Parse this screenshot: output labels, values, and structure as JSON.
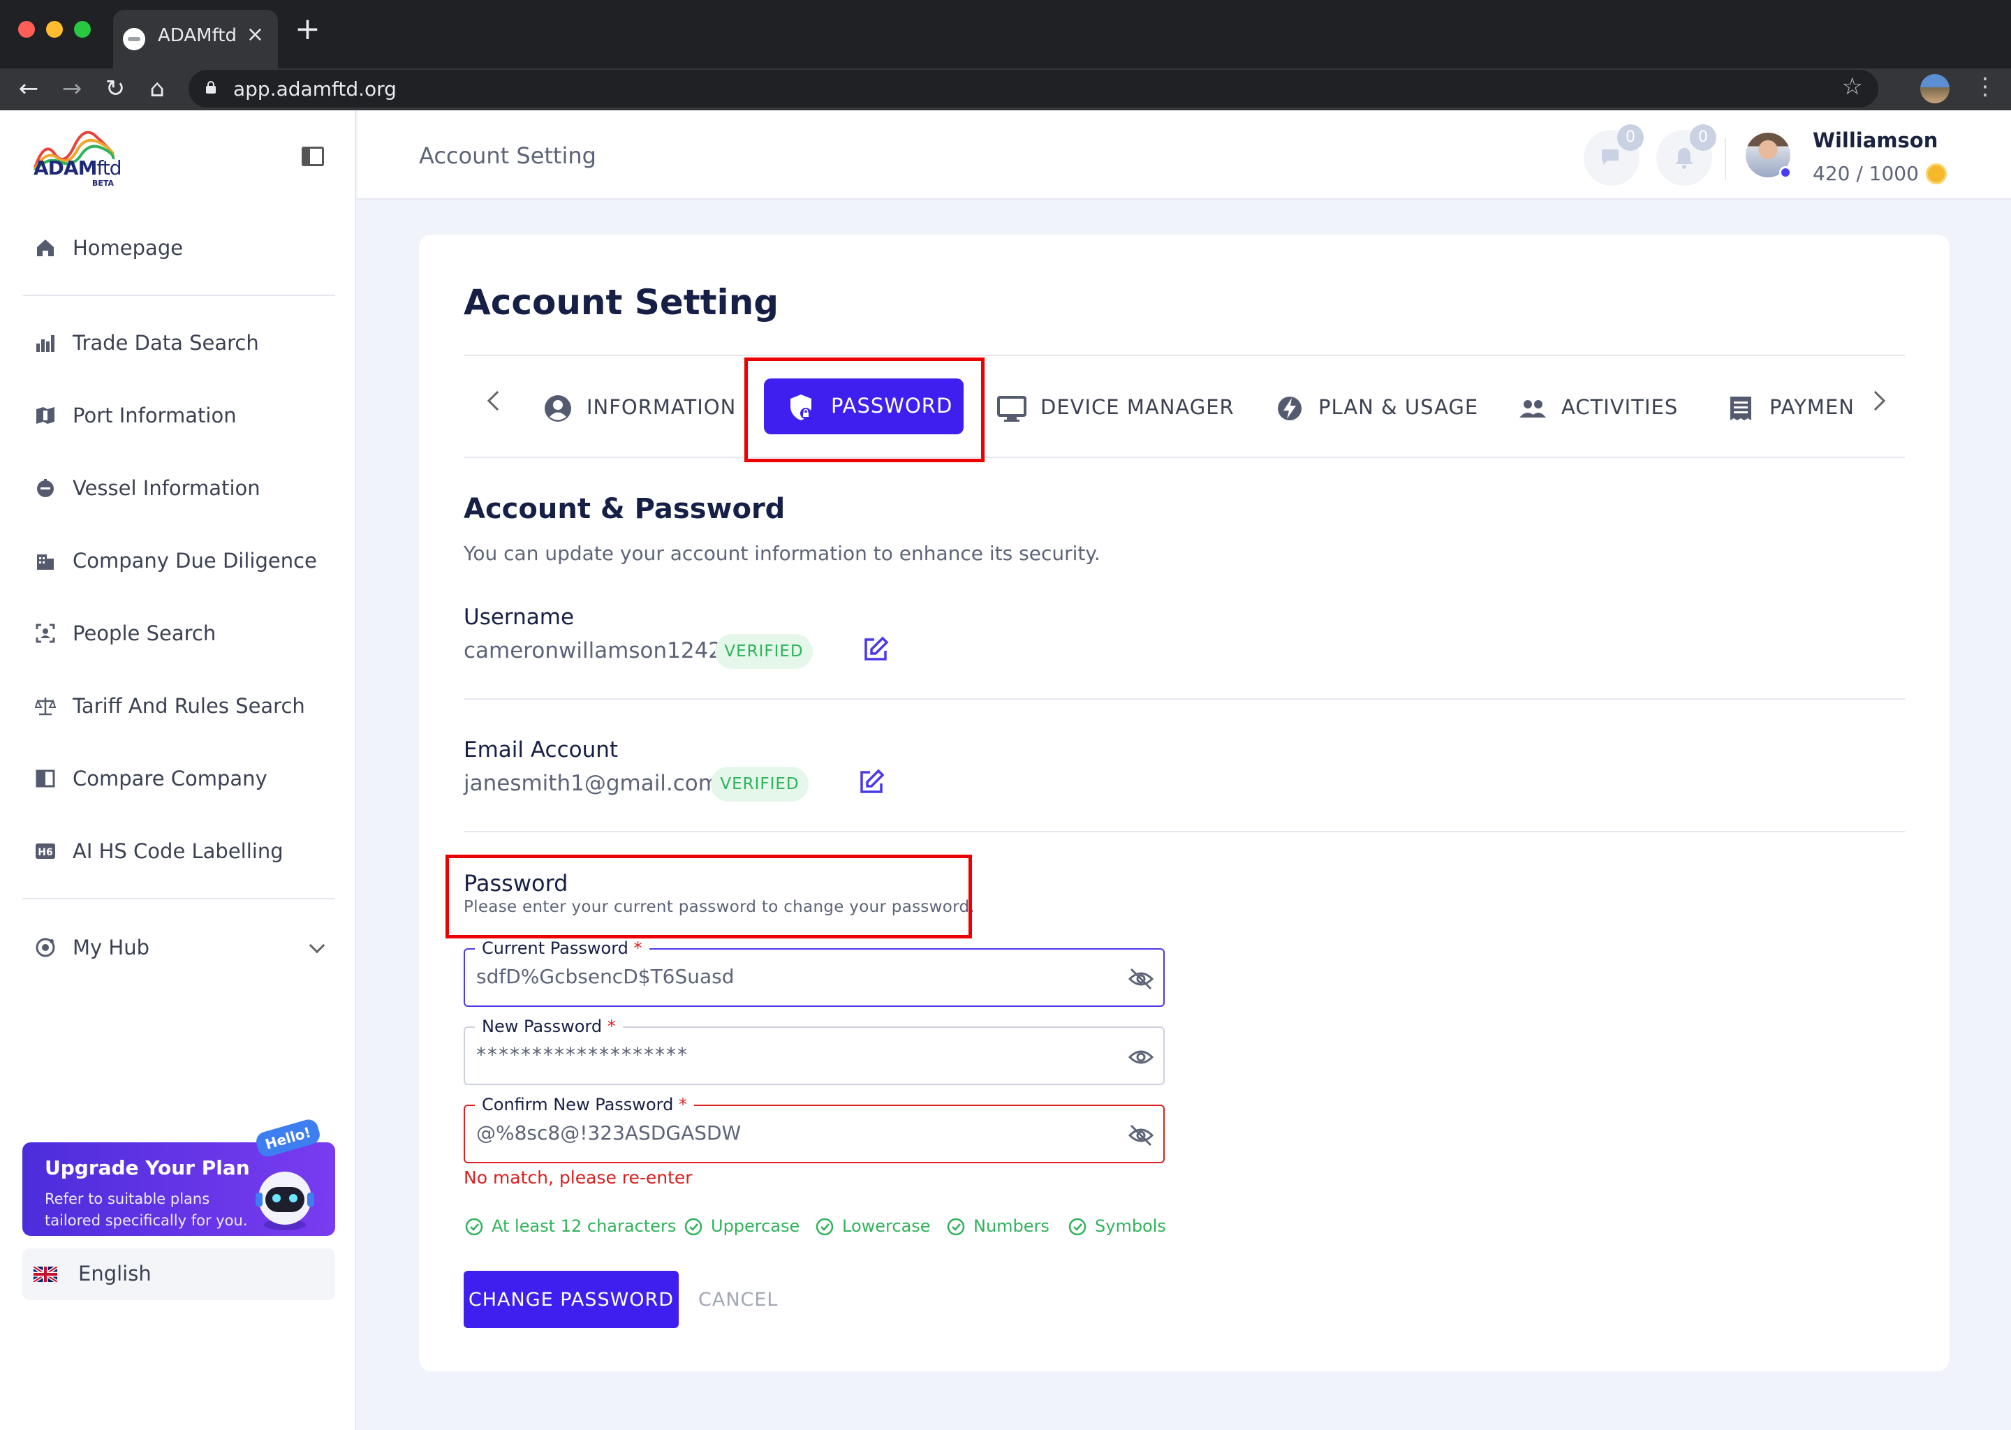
{
  "browser": {
    "tab_title": "ADAMftd",
    "url": "app.adamftd.org"
  },
  "sidebar": {
    "logo_main": "ADAM",
    "logo_suffix": "ftd",
    "logo_beta": "BETA",
    "items": [
      {
        "label": "Homepage",
        "icon": "home-icon"
      },
      {
        "label": "Trade Data Search",
        "icon": "bar-chart-icon"
      },
      {
        "label": "Port Information",
        "icon": "port-icon"
      },
      {
        "label": "Vessel Information",
        "icon": "vessel-icon"
      },
      {
        "label": "Company Due Diligence",
        "icon": "building-icon"
      },
      {
        "label": "People Search",
        "icon": "person-scan-icon"
      },
      {
        "label": "Tariff And Rules Search",
        "icon": "scale-icon"
      },
      {
        "label": "Compare Company",
        "icon": "compare-icon"
      },
      {
        "label": "AI HS Code Labelling",
        "icon": "hs-code-icon"
      },
      {
        "label": "My Hub",
        "icon": "hub-icon"
      }
    ],
    "upgrade": {
      "title": "Upgrade Your Plan",
      "description": "Refer to suitable plans tailored specifically for you.",
      "bubble": "Hello!"
    },
    "language": "English"
  },
  "header": {
    "title": "Account Setting",
    "messages_count": "0",
    "notifications_count": "0",
    "user_name": "Williamson",
    "credits": "420 / 1000"
  },
  "main": {
    "title": "Account Setting",
    "tabs": [
      {
        "label": "INFORMATION",
        "icon": "user-circle-icon"
      },
      {
        "label": "PASSWORD",
        "icon": "shield-lock-icon",
        "active": true
      },
      {
        "label": "DEVICE MANAGER",
        "icon": "monitor-icon"
      },
      {
        "label": "PLAN & USAGE",
        "icon": "lightning-icon"
      },
      {
        "label": "ACTIVITIES",
        "icon": "people-icon"
      },
      {
        "label": "PAYMEN",
        "icon": "receipt-icon"
      }
    ],
    "section_title": "Account & Password",
    "section_subtitle": "You can update your account information to enhance its security.",
    "username": {
      "label": "Username",
      "value": "cameronwillamson1242",
      "badge": "VERIFIED"
    },
    "email": {
      "label": "Email Account",
      "value": "janesmith1@gmail.com",
      "badge": "VERIFIED"
    },
    "password_section": {
      "title": "Password",
      "subtitle": "Please enter your current password to change your password."
    },
    "fields": {
      "current": {
        "label": "Current Password",
        "value": "sdfD%GcbsencD$T6Suasd"
      },
      "new": {
        "label": "New Password",
        "value": "*******************"
      },
      "confirm": {
        "label": "Confirm New Password",
        "value": "@%8sc8@!323ASDGASDW"
      },
      "required_mark": "*"
    },
    "error": "No match, please re-enter",
    "rules": [
      "At least 12 characters",
      "Uppercase",
      "Lowercase",
      "Numbers",
      "Symbols"
    ],
    "buttons": {
      "change": "CHANGE PASSWORD",
      "cancel": "CANCEL"
    }
  },
  "colors": {
    "accent": "#3e1ff0",
    "success": "#2fb35a",
    "error": "#e02020",
    "highlight": "#ee0000"
  }
}
